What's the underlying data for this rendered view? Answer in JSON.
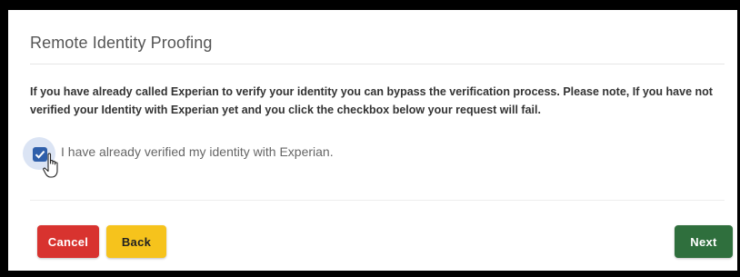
{
  "dialog": {
    "title": "Remote Identity Proofing",
    "notice": "If you have already called Experian to verify your identity you can bypass the verification process. Please note, If you have not verified your Identity with Experian yet and you click the checkbox below your request will fail.",
    "checkbox": {
      "label": "I have already verified my identity with Experian.",
      "checked": true
    }
  },
  "buttons": {
    "cancel": "Cancel",
    "back": "Back",
    "next": "Next"
  },
  "colors": {
    "cancel": "#d8332f",
    "back": "#f6c31c",
    "next": "#2f6f3d",
    "checkbox": "#2f5faa"
  },
  "icons": {
    "checkmark": "check-icon",
    "cursor": "hand-pointer-icon"
  }
}
